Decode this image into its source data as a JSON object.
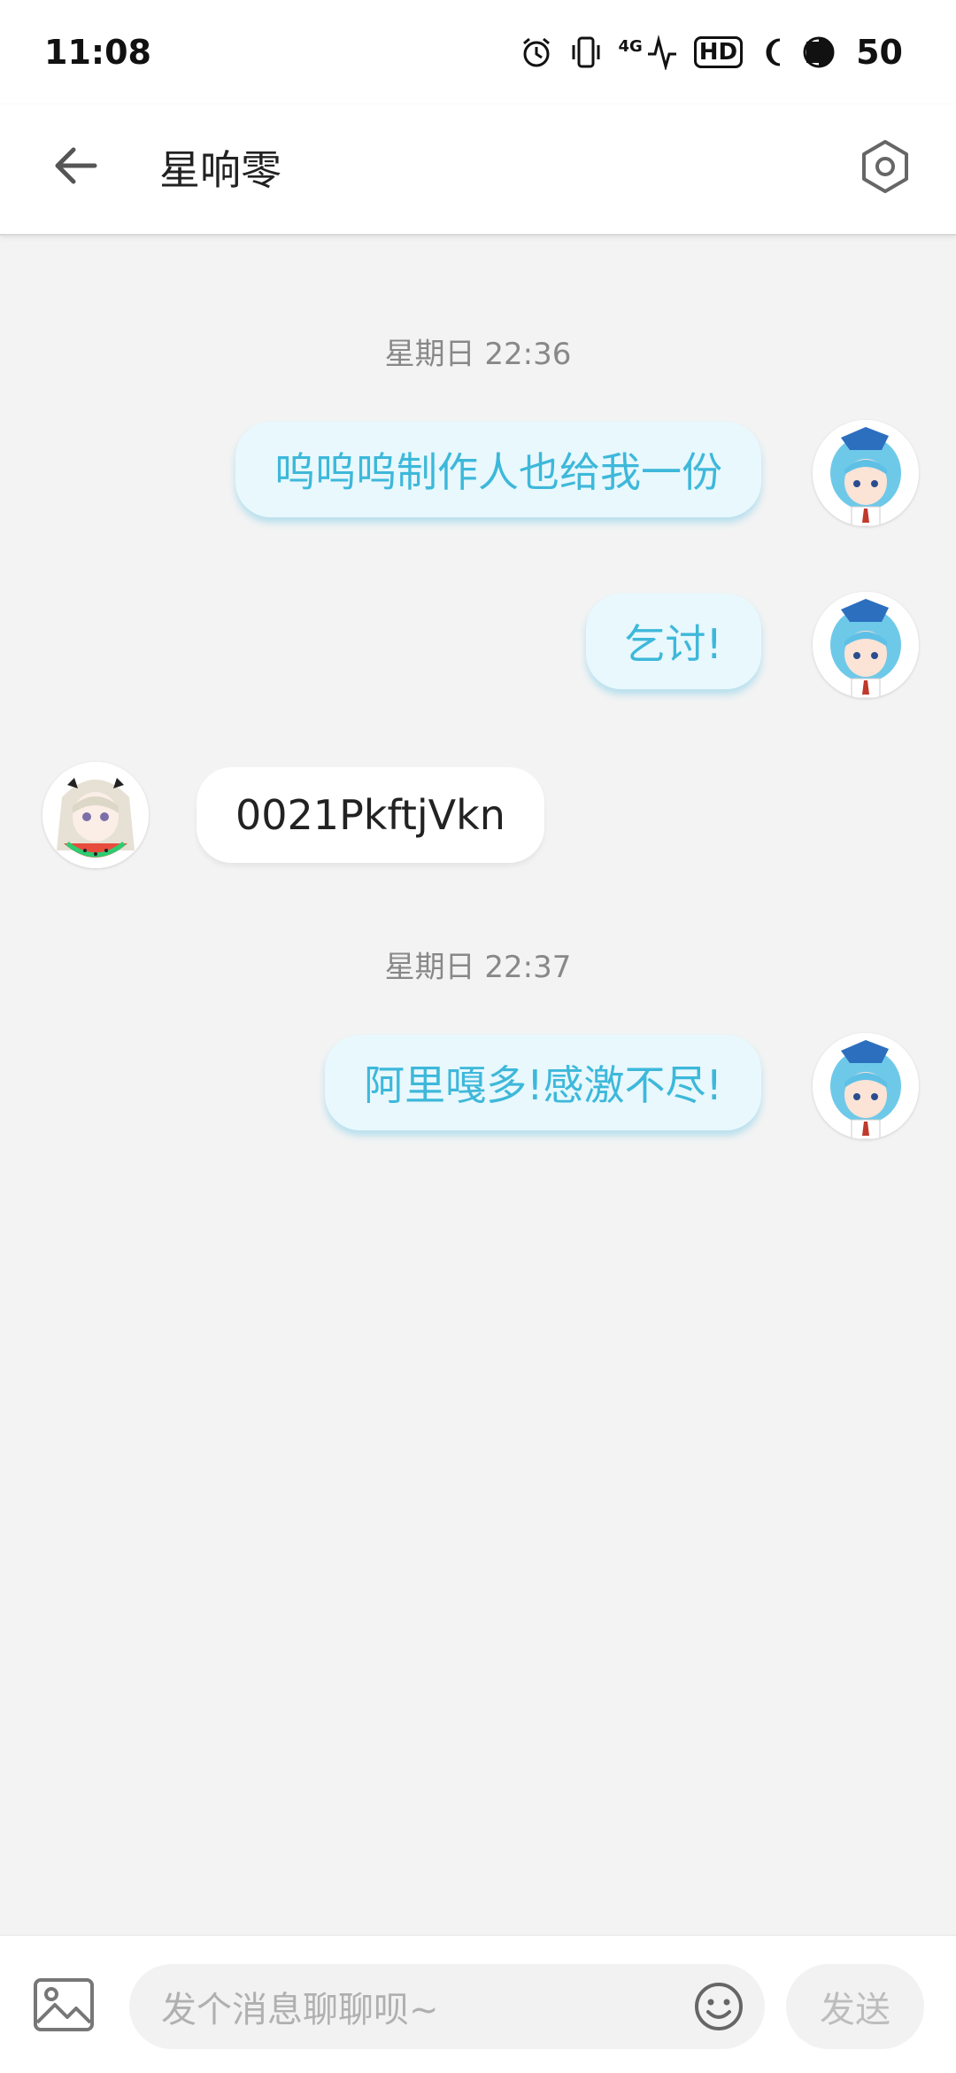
{
  "status_bar": {
    "time": "11:08",
    "network": "4G",
    "hd": "HD",
    "battery": "50"
  },
  "header": {
    "title": "星响零"
  },
  "messages": [
    {
      "type": "timestamp",
      "text": "星期日 22:36"
    },
    {
      "type": "message",
      "sender": "me",
      "text": "呜呜呜制作人也给我一份"
    },
    {
      "type": "message",
      "sender": "me",
      "text": "乞讨!"
    },
    {
      "type": "message",
      "sender": "other",
      "text": "0021PkftjVkn"
    },
    {
      "type": "timestamp",
      "text": "星期日 22:37"
    },
    {
      "type": "message",
      "sender": "me",
      "text": "阿里嘎多!感激不尽!"
    }
  ],
  "input": {
    "placeholder": "发个消息聊聊呗~",
    "send_label": "发送"
  },
  "colors": {
    "my_bubble_bg": "#e8f8fd",
    "my_bubble_text": "#3db8da",
    "background": "#f3f3f3"
  },
  "icons": {
    "back": "arrow-left-icon",
    "settings": "hexagon-gear-icon",
    "image": "image-icon",
    "emoji": "smiley-icon"
  }
}
